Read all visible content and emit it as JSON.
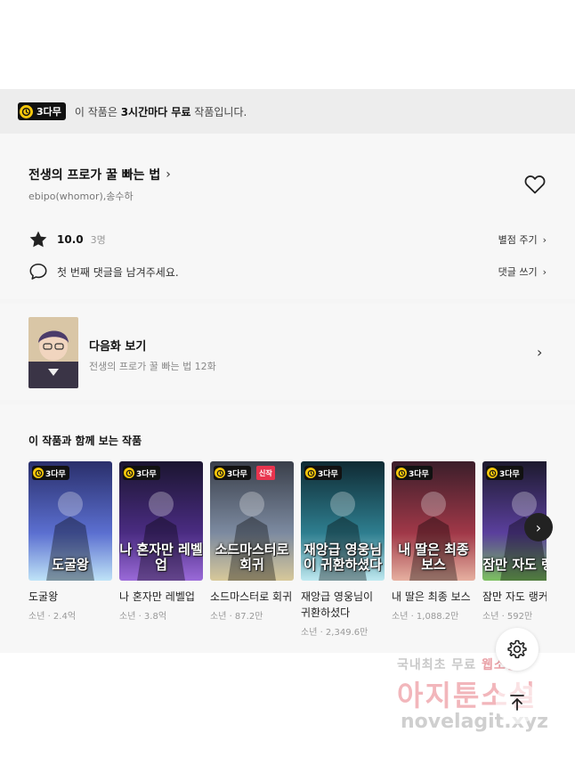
{
  "free_banner": {
    "badge": "3다무",
    "text_prefix": "이 작품은 ",
    "text_bold": "3시간마다 무료",
    "text_suffix": " 작품입니다."
  },
  "work": {
    "title": "전생의 프로가 꿀 빠는 법",
    "authors": "ebipo(whomor),송수하",
    "rating": "10.0",
    "rating_count": "3명",
    "rate_link": "별점 주기",
    "comment_prompt": "첫 번째 댓글을 남겨주세요.",
    "comment_link": "댓글 쓰기"
  },
  "next_episode": {
    "title": "다음화 보기",
    "subtitle": "전생의 프로가 꿀 빠는 법 12화"
  },
  "recommendations": {
    "heading": "이 작품과 함께 보는 작품",
    "items": [
      {
        "badge": "3다무",
        "cover_text": "도굴왕",
        "name": "도굴왕",
        "meta": "소년 · 2.4억",
        "colors": [
          "#2a2f6b",
          "#5b6fd0",
          "#bfe3f7"
        ]
      },
      {
        "badge": "3다무",
        "cover_text": "나 혼자만 레벨업",
        "name": "나 혼자만 레벨업",
        "meta": "소년 · 3.8억",
        "colors": [
          "#1b1530",
          "#4a2c82",
          "#9a6ad8"
        ]
      },
      {
        "badge": "3다무",
        "new": "신작",
        "cover_text": "소드마스터로 회귀",
        "name": "소드마스터로 회귀",
        "meta": "소년 · 87.2만",
        "colors": [
          "#3a3f4a",
          "#7c8aa0",
          "#d7c89a"
        ]
      },
      {
        "badge": "3다무",
        "cover_text": "재앙급 영웅님이 귀환하셨다",
        "name": "재앙급 영웅님이 귀환하셨다",
        "meta": "소년 · 2,349.6만",
        "colors": [
          "#0f2a33",
          "#2e7e8f",
          "#bfe9f0"
        ]
      },
      {
        "badge": "3다무",
        "cover_text": "내 딸은 최종 보스",
        "name": "내 딸은 최종 보스",
        "meta": "소년 · 1,088.2만",
        "colors": [
          "#3b1e2a",
          "#a03848",
          "#e6b0a0"
        ]
      },
      {
        "badge": "3다무",
        "cover_text": "잠만 자도 랭커",
        "name": "잠만 자도 랭커",
        "meta": "소년 · 592만",
        "colors": [
          "#1d1a2e",
          "#5a3f9c",
          "#7cc060"
        ]
      }
    ]
  },
  "watermark": {
    "line1_prefix": "국내최초 무료 ",
    "line1_highlight": "웹소설",
    "line2": "아지툰소설",
    "line3": "novelagit.xyz"
  },
  "icons": {
    "heart": "heart-icon",
    "star": "star-icon",
    "comment": "comment-bubble-icon",
    "gear": "gear-icon",
    "top": "arrow-up-icon",
    "next": "chevron-right-icon"
  },
  "colors": {
    "badge_bg": "#111111",
    "clock": "#f7c70b",
    "new_tag": "#e8344e",
    "section_bg": "#f7f7f7",
    "banner_bg": "#ededed"
  }
}
